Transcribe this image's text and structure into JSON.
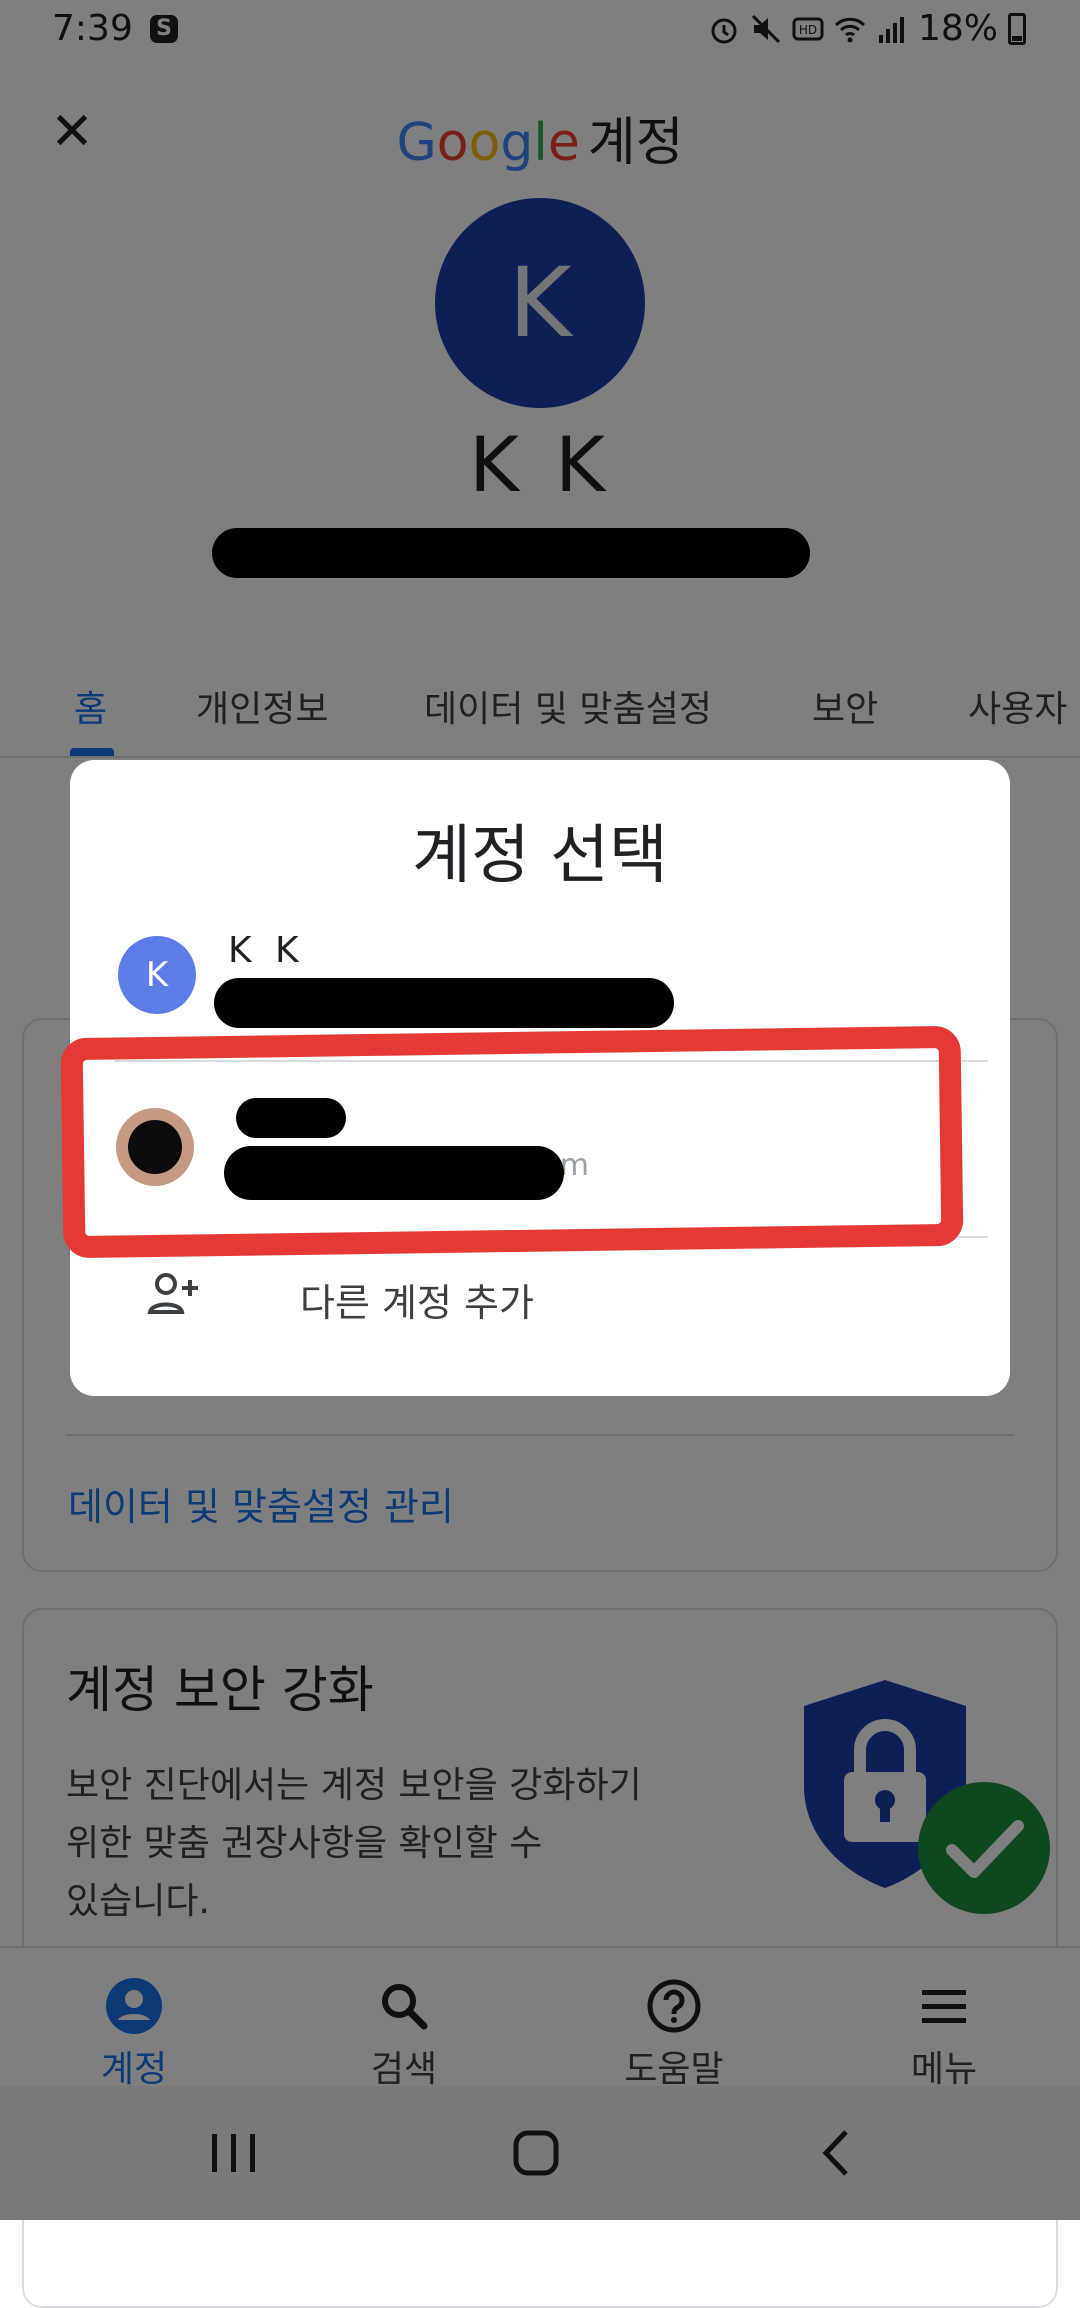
{
  "status_bar": {
    "time": "7:39",
    "s_icon": "S",
    "battery_percent": "18%",
    "icons": [
      "alarm-icon",
      "mute-icon",
      "hd-icon",
      "wifi-icon",
      "signal-icon",
      "battery-icon"
    ]
  },
  "header": {
    "close_icon": "close-icon",
    "google_letters": [
      "G",
      "o",
      "o",
      "g",
      "l",
      "e"
    ],
    "title_suffix": "계정"
  },
  "profile": {
    "avatar_letter": "K",
    "name": "K K",
    "avatar_color": "#1a3fa8"
  },
  "tabs": [
    {
      "label": "홈",
      "active": true
    },
    {
      "label": "개인정보",
      "active": false
    },
    {
      "label": "데이터 및 맞춤설정",
      "active": false
    },
    {
      "label": "보안",
      "active": false
    },
    {
      "label": "사용자",
      "active": false
    }
  ],
  "cards": {
    "data_link": "데이터 및 맞춤설정 관리",
    "security": {
      "title": "계정 보안 강화",
      "lines": [
        "보안 진단에서는 계정 보안을 강화하기",
        "위한 맞춤 권장사항을 확인할 수",
        "있습니다."
      ]
    }
  },
  "bottom_nav": [
    {
      "label": "계정",
      "icon": "account-circle-icon",
      "active": true
    },
    {
      "label": "검색",
      "icon": "search-icon",
      "active": false
    },
    {
      "label": "도움말",
      "icon": "help-icon",
      "active": false
    },
    {
      "label": "메뉴",
      "icon": "menu-icon",
      "active": false
    }
  ],
  "dialog": {
    "title": "계정 선택",
    "accounts": [
      {
        "avatar_letter": "K",
        "name": "K K",
        "email_redacted": true
      },
      {
        "avatar": "photo",
        "name_redacted": true,
        "email_visible_fragment": "@gmail.com",
        "email_redacted": true
      }
    ],
    "add_account_label": "다른 계정 추가",
    "add_account_icon": "person-add-icon"
  },
  "colors": {
    "accent": "#1a73e8",
    "highlight": "#e53935",
    "shield": "#1a3fa8",
    "check": "#1e8e3e"
  }
}
